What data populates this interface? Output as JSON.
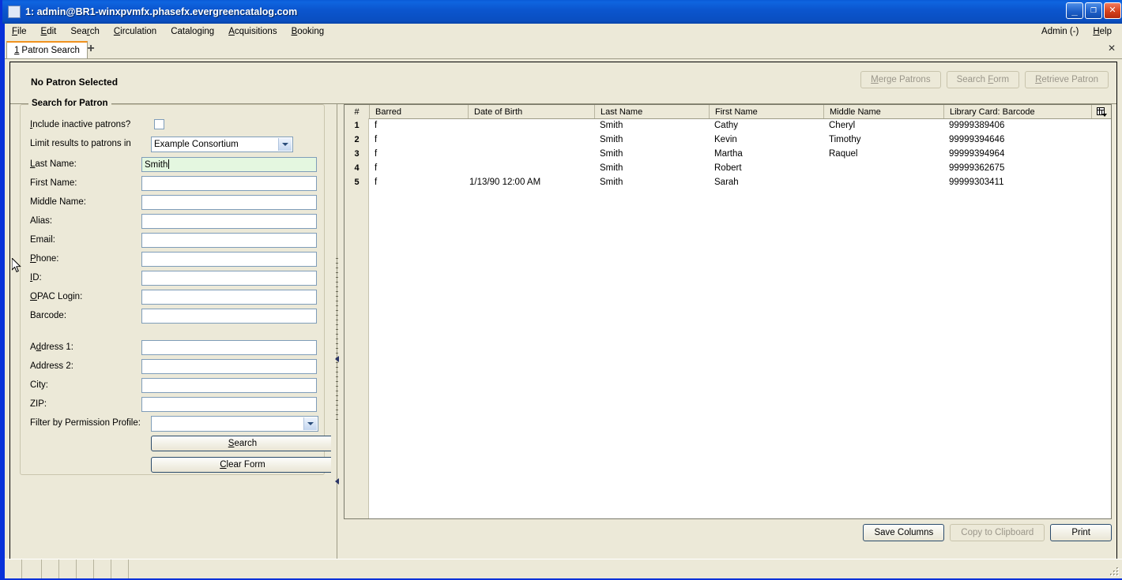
{
  "window": {
    "title": "1: admin@BR1-winxpvmfx.phasefx.evergreencatalog.com",
    "minimize_label": "_",
    "maximize_label": "❐",
    "close_label": "✕",
    "titlebar_color": "#0b56cf",
    "chrome_color": "#ece9d8"
  },
  "menubar": {
    "items": [
      {
        "label": "File",
        "accel": "F"
      },
      {
        "label": "Edit",
        "accel": "E"
      },
      {
        "label": "Search",
        "accel": "r"
      },
      {
        "label": "Circulation",
        "accel": "C"
      },
      {
        "label": "Cataloging",
        "accel": "g"
      },
      {
        "label": "Acquisitions",
        "accel": "A"
      },
      {
        "label": "Booking",
        "accel": "B"
      }
    ],
    "right_items": [
      {
        "label": "Admin (-)"
      },
      {
        "label": "Help",
        "accel": "H"
      }
    ]
  },
  "tabs": {
    "items": [
      {
        "number": "1",
        "label": "Patron Search"
      }
    ],
    "add_label": "+",
    "close_label": "✕"
  },
  "patron_bar": {
    "status": "No Patron Selected",
    "buttons": [
      {
        "label": "Merge Patrons",
        "enabled": false
      },
      {
        "label": "Search Form",
        "enabled": false
      },
      {
        "label": "Retrieve Patron",
        "enabled": false
      }
    ]
  },
  "search_form": {
    "legend": "Search for Patron",
    "fields": [
      {
        "label": "Include inactive patrons?",
        "type": "checkbox",
        "value": "",
        "checked": false
      },
      {
        "label": "Limit results to patrons in",
        "type": "select",
        "value": "Example Consortium"
      },
      {
        "label": "Last Name:",
        "type": "text",
        "value": "Smith",
        "focused": true
      },
      {
        "label": "First Name:",
        "type": "text",
        "value": ""
      },
      {
        "label": "Middle Name:",
        "type": "text",
        "value": ""
      },
      {
        "label": "Alias:",
        "type": "text",
        "value": ""
      },
      {
        "label": "Email:",
        "type": "text",
        "value": ""
      },
      {
        "label": "Phone:",
        "type": "text",
        "value": ""
      },
      {
        "label": "ID:",
        "type": "text",
        "value": ""
      },
      {
        "label": "OPAC Login:",
        "type": "text",
        "value": ""
      },
      {
        "label": "Barcode:",
        "type": "text",
        "value": ""
      },
      {
        "label": "Address 1:",
        "type": "text",
        "value": ""
      },
      {
        "label": "Address 2:",
        "type": "text",
        "value": ""
      },
      {
        "label": "City:",
        "type": "text",
        "value": ""
      },
      {
        "label": "ZIP:",
        "type": "text",
        "value": ""
      },
      {
        "label": "Filter by Permission Profile:",
        "type": "select",
        "value": ""
      }
    ],
    "search_button": "Search",
    "clear_button": "Clear Form"
  },
  "results": {
    "columns": [
      "#",
      "Barred",
      "Date of Birth",
      "Last Name",
      "First Name",
      "Middle Name",
      "Library Card: Barcode"
    ],
    "column_picker_icon": "grid-columns-icon",
    "rows": [
      {
        "num": "1",
        "barred": "f",
        "dob": "",
        "last": "Smith",
        "first": "Cathy",
        "middle": "Cheryl",
        "barcode": "99999389406"
      },
      {
        "num": "2",
        "barred": "f",
        "dob": "",
        "last": "Smith",
        "first": "Kevin",
        "middle": "Timothy",
        "barcode": "99999394646"
      },
      {
        "num": "3",
        "barred": "f",
        "dob": "",
        "last": "Smith",
        "first": "Martha",
        "middle": "Raquel",
        "barcode": "99999394964"
      },
      {
        "num": "4",
        "barred": "f",
        "dob": "",
        "last": "Smith",
        "first": "Robert",
        "middle": "",
        "barcode": "99999362675"
      },
      {
        "num": "5",
        "barred": "f",
        "dob": "1/13/90 12:00 AM",
        "last": "Smith",
        "first": "Sarah",
        "middle": "",
        "barcode": "99999303411"
      }
    ],
    "buttons": [
      {
        "label": "Save Columns",
        "enabled": true
      },
      {
        "label": "Copy to Clipboard",
        "enabled": false
      },
      {
        "label": "Print",
        "enabled": true
      }
    ]
  },
  "statusbar": {
    "segments": [
      "",
      "",
      "",
      "",
      "",
      "",
      ""
    ]
  }
}
